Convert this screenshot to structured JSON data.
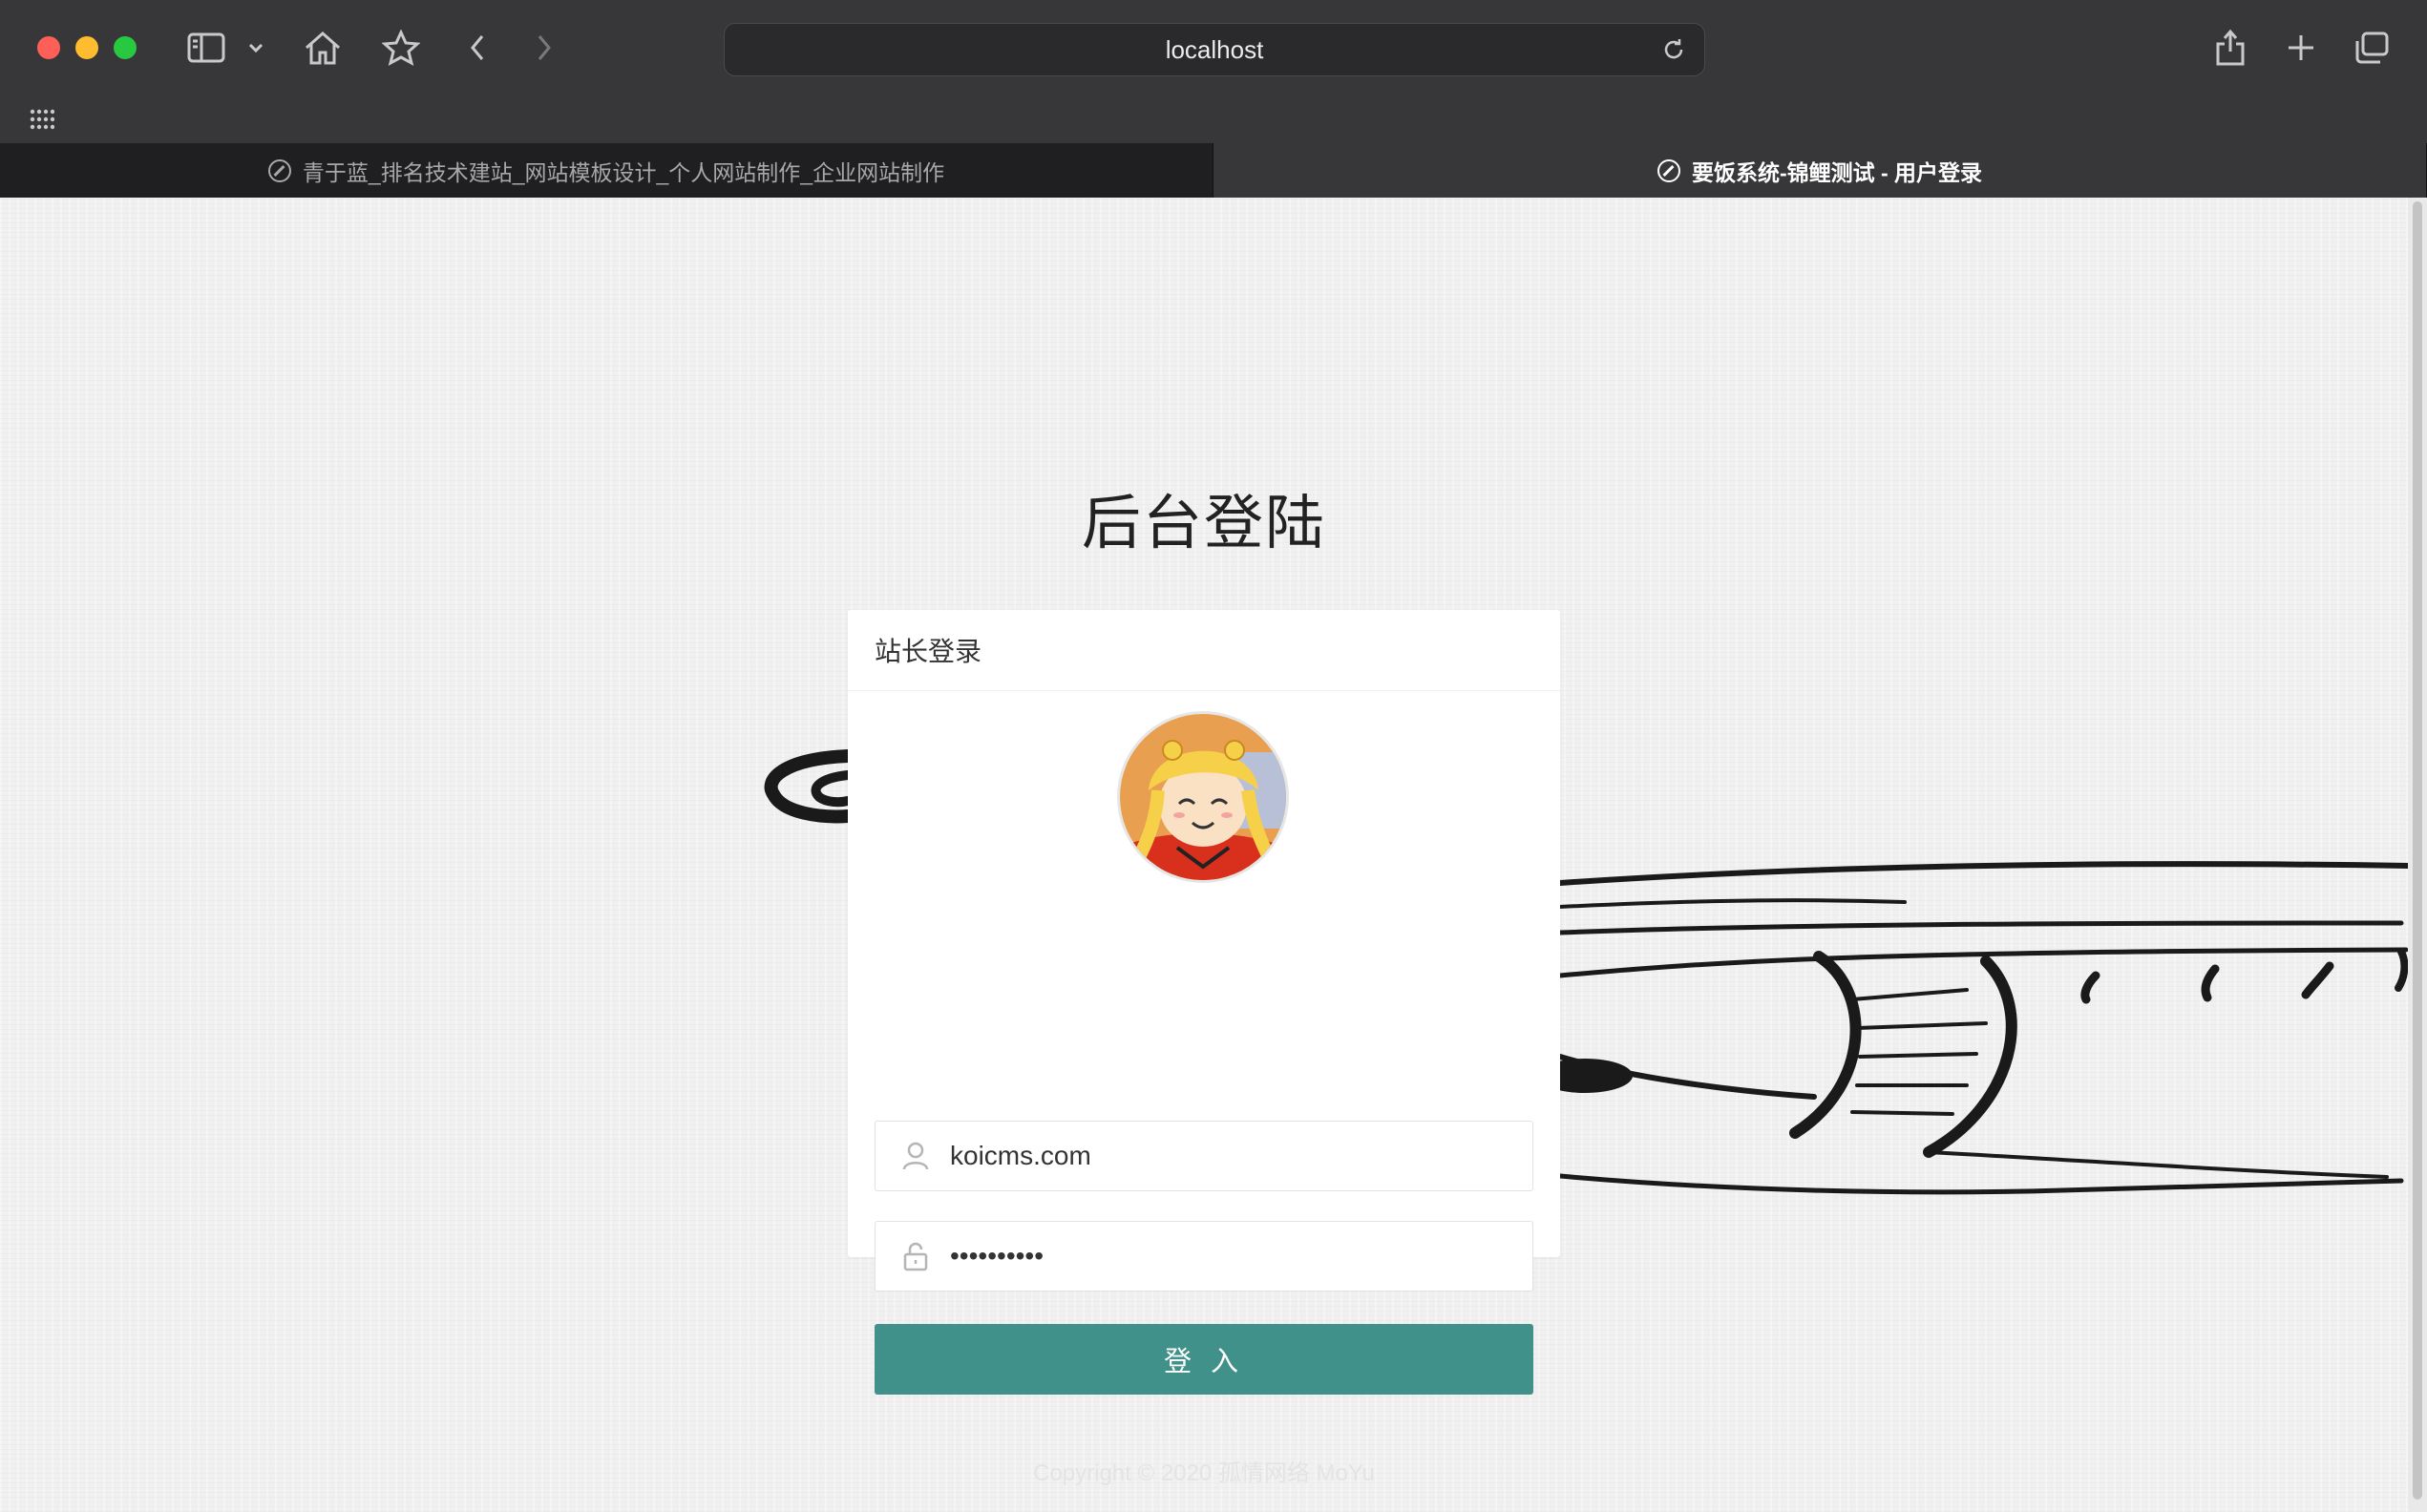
{
  "browser": {
    "url": "localhost",
    "tabs": [
      {
        "title": "青于蓝_排名技术建站_网站模板设计_个人网站制作_企业网站制作",
        "active": false
      },
      {
        "title": "要饭系统-锦鲤测试 - 用户登录",
        "active": true
      }
    ]
  },
  "page": {
    "title": "后台登陆",
    "card_header": "站长登录",
    "username_value": "koicms.com",
    "password_value": "••••••••••",
    "login_button": "登 入",
    "copyright": "Copyright © 2020  孤情网络 MoYu"
  },
  "colors": {
    "accent": "#3f918a",
    "chrome": "#37373a",
    "page_bg": "#f0f0f0"
  },
  "icons": [
    "sidebar-icon",
    "home-icon",
    "star-icon",
    "back-icon",
    "forward-icon",
    "reload-icon",
    "share-icon",
    "plus-icon",
    "tabs-overview-icon",
    "grid-icon",
    "compass-icon",
    "user-icon",
    "lock-icon"
  ]
}
